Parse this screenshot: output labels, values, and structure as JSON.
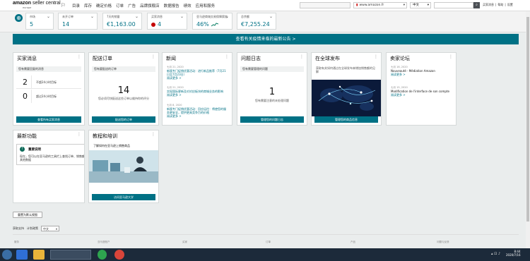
{
  "brand": {
    "name_bold": "amazon",
    "name_rest": " seller central",
    "region": "europe"
  },
  "nav": [
    "目录",
    "库存",
    "确定价格",
    "订单",
    "广告",
    "品牌旗舰店",
    "数据报告",
    "绩效",
    "应用和服务"
  ],
  "topbar": {
    "marketplace": "www.amazon.fr",
    "language": "中文",
    "help_links": [
      "买家消息",
      "帮助",
      "设置"
    ]
  },
  "metrics": [
    {
      "label": "市场",
      "value": "5"
    },
    {
      "label": "未开订单",
      "value": "14"
    },
    {
      "label": "7天的销量",
      "value": "€1,163.00"
    },
    {
      "label": "买家消息",
      "value": "4"
    },
    {
      "label": "亚马逊商城交易保障索赔",
      "value": "46%"
    },
    {
      "label": "总余额",
      "value": "€7,255.24"
    }
  ],
  "banner": "查看有关疫情来临的最新公告 >",
  "cards": {
    "buyer_messages": {
      "title": "买家消息",
      "subtitle": "您有需要回复的消息",
      "rows": [
        {
          "num": "2",
          "text": "不超24小时目标"
        },
        {
          "num": "0",
          "text": "超过24小时目标"
        }
      ],
      "button": "查看所有买家消息"
    },
    "shipment": {
      "title": "配送订单",
      "subtitle": "您有要配送的订单",
      "number": "14",
      "desc": "您必须尽快配送这些订单以维持你的评分",
      "button": "配送您的订单"
    },
    "news": {
      "title": "新闻",
      "items": [
        {
          "date": "七月 21, 2020",
          "title": "新版专门促销优惠活动：进行新品推荐（7月21日至7月23日）",
          "more": "阅读更多 >"
        },
        {
          "date": "七月 21, 2020",
          "title": "实现国际更新及对对应板块的商城业务的影响",
          "more": "阅读更多 >"
        },
        {
          "date": "七月 8, 2020",
          "title": "新版专门促销优惠活动：回应运往：将使您的服务更安全，提供更具竞争力的价格",
          "more": "阅读更多 >"
        }
      ]
    },
    "issue_log": {
      "title": "问题日志",
      "subtitle": "您有需要管理的问题",
      "number": "1",
      "desc": "您有需要注意的未处理问题",
      "button": "管理您的问题日志"
    },
    "global": {
      "title": "在全球发布",
      "desc": "获取有关如何通过在全球发布来增加销售额的见解",
      "button": "管理您的商品信息"
    },
    "forum": {
      "title": "卖家论坛",
      "items": [
        {
          "date": "七月 16, 2020",
          "title": "Nouveauté - Médiation Amazon",
          "more": "阅读更多 >"
        },
        {
          "date": "七月 15, 2020",
          "title": "Modification de l'interface de son compte",
          "more": "阅读更多 >"
        }
      ]
    },
    "features": {
      "title": "最新功能",
      "heading": "重要说明",
      "text": "现在，您可以在亚马逊的工具栏上查找订单、销售额和其他数据"
    },
    "training": {
      "title": "教程和培训",
      "subtitle": "了解如何在亚马逊上销售商品",
      "button": "访问亚马逊大学"
    }
  },
  "reset_button": "重置为默认视图",
  "bottom": {
    "label1": "获取支持",
    "label2": "计划政策",
    "select": "中文"
  },
  "footer_cols": [
    "服务",
    "亚马逊账户",
    "买家",
    "订单",
    "产品",
    "问题与反馈"
  ],
  "taskbar": {
    "time": "8:44",
    "date": "2020/7/16"
  },
  "colors": {
    "teal": "#007185",
    "red": "#c40000"
  }
}
